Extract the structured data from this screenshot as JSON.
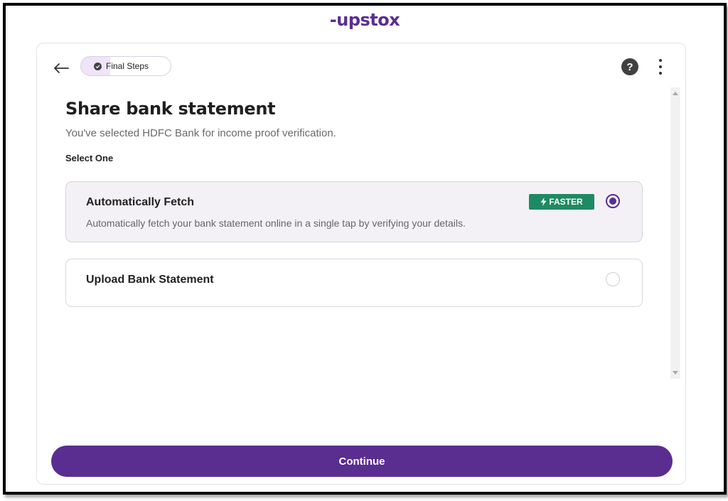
{
  "brand": {
    "logo_text": "upstox",
    "color": "#5a2d91"
  },
  "header": {
    "step_pill": "Final Steps",
    "help_icon": "question-circle-icon",
    "menu_icon": "more-vertical-icon",
    "back_icon": "arrow-left-icon"
  },
  "main": {
    "title": "Share bank statement",
    "subtitle": "You've selected HDFC Bank for income proof verification.",
    "select_label": "Select One",
    "options": [
      {
        "title": "Automatically Fetch",
        "description": "Automatically fetch your bank statement online in a single tap by verifying your details.",
        "badge": "FASTER",
        "badge_icon": "lightning-icon",
        "badge_color": "#1e8a63",
        "selected": true
      },
      {
        "title": "Upload Bank Statement",
        "selected": false
      }
    ]
  },
  "footer": {
    "continue_label": "Continue"
  }
}
